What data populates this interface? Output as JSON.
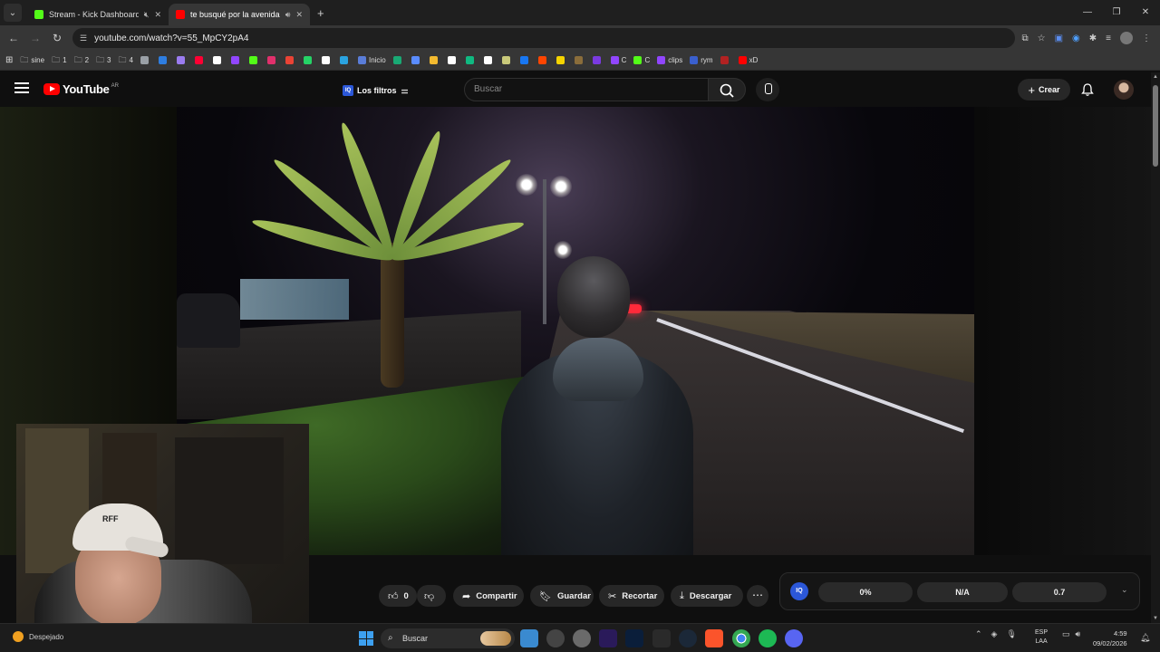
{
  "browser": {
    "tabs": [
      {
        "title": "Stream - Kick Dashboard",
        "favicon_color": "#53fc18",
        "muted_icon": "speaker-muted-icon"
      },
      {
        "title": "te busqué por la avenida(",
        "favicon_color": "#ff0000",
        "audio_icon": "speaker-icon"
      }
    ],
    "url": "youtube.com/watch?v=55_MpCY2pA4",
    "bookmarks": [
      {
        "label": "sine",
        "type": "folder"
      },
      {
        "label": "1",
        "type": "folder"
      },
      {
        "label": "2",
        "type": "folder"
      },
      {
        "label": "3",
        "type": "folder"
      },
      {
        "label": "4",
        "type": "folder"
      },
      {
        "label": "",
        "color": "#9aa0a6"
      },
      {
        "label": "",
        "color": "#2e7de0"
      },
      {
        "label": "",
        "color": "#9b7cf0"
      },
      {
        "label": "",
        "color": "#ff0033"
      },
      {
        "label": "",
        "color": "#ffffff"
      },
      {
        "label": "",
        "color": "#9146ff"
      },
      {
        "label": "",
        "color": "#53fc18"
      },
      {
        "label": "",
        "color": "#e1306c"
      },
      {
        "label": "",
        "color": "#ea4335"
      },
      {
        "label": "",
        "color": "#25d366"
      },
      {
        "label": "",
        "color": "#ffffff"
      },
      {
        "label": "",
        "color": "#2aa3e0"
      },
      {
        "label": "Inicio",
        "color": "#5a7dd8"
      },
      {
        "label": "",
        "color": "#19a974"
      },
      {
        "label": "",
        "color": "#5a8cff"
      },
      {
        "label": "",
        "color": "#f3ba2f"
      },
      {
        "label": "",
        "color": "#ffffff"
      },
      {
        "label": "",
        "color": "#10b981"
      },
      {
        "label": "",
        "color": "#ffffff"
      },
      {
        "label": "",
        "color": "#c9c97a"
      },
      {
        "label": "",
        "color": "#1877f2"
      },
      {
        "label": "",
        "color": "#ff4500"
      },
      {
        "label": "",
        "color": "#f5d400"
      },
      {
        "label": "",
        "color": "#8a6d3b"
      },
      {
        "label": "",
        "color": "#7a3ae0"
      },
      {
        "label": "C",
        "color": "#9146ff"
      },
      {
        "label": "C",
        "color": "#53fc18"
      },
      {
        "label": "clips",
        "color": "#9146ff"
      },
      {
        "label": "rym",
        "color": "#3a5fcd"
      },
      {
        "label": "",
        "color": "#b22222"
      },
      {
        "label": "xD",
        "color": "#ff0000"
      }
    ]
  },
  "youtube": {
    "logo_text": "YouTube",
    "country_code": "AR",
    "filters_label": "Los filtros",
    "search_placeholder": "Buscar",
    "create_label": "Crear",
    "actions": {
      "like_count": "0",
      "share_label": "Compartir",
      "save_label": "Guardar",
      "clip_label": "Recortar",
      "download_label": "Descargar"
    },
    "extension": {
      "badge": "IQ",
      "values": [
        "0%",
        "N/A",
        "0.7"
      ]
    }
  },
  "webcam": {
    "cap_text": "RFF"
  },
  "taskbar": {
    "weather_label": "Despejado",
    "search_label": "Buscar",
    "language": "ESP",
    "layout": "LAA",
    "time": "4:59",
    "date": "09/02/2026"
  }
}
